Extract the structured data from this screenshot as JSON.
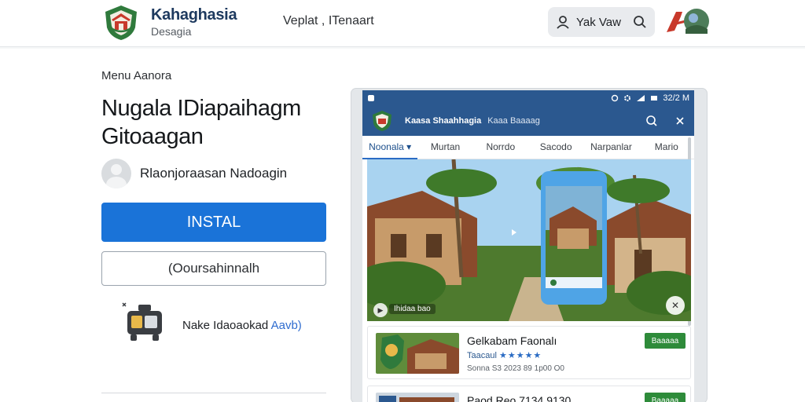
{
  "header": {
    "brand_title": "Kahaghasia",
    "brand_subtitle": "Desagia",
    "nav_text": "Veplat , ITenaart",
    "search_label": "Yak Vaw"
  },
  "main": {
    "breadcrumb": "Menu Aanora",
    "app_title": "Nugala IDiapaihagm Gitoaagan",
    "developer": "Rlaonjoraasan Nadoagin",
    "install_label": "INSTAL",
    "secondary_label": "(Ooursahinnalh",
    "feature_text": "Nake Idaoaokad",
    "feature_accent": "Aavb)"
  },
  "screenshot": {
    "statusbar_time": "32/2 M",
    "appbar_title": "Kaasa Shaahhagia",
    "appbar_subtitle": "Kaaa Baaaag",
    "tabs": [
      "Noonala",
      "Murtan",
      "Norrdo",
      "Sacodo",
      "Narpanlar",
      "Mario"
    ],
    "hero_tag": "Ihidaa bao",
    "items": [
      {
        "title": "Gelkabam Faonalı",
        "subtitle": "Taacaul",
        "stars": "★★★★★",
        "meta": "Sonna S3 2023 89 1p00 O0",
        "button": "Baaaaa"
      },
      {
        "title": "Paod Reo 7134 9130",
        "subtitle": "",
        "stars": "",
        "meta": "",
        "button": "Baaaaa"
      }
    ]
  },
  "colors": {
    "primary": "#1a73d8",
    "appbar": "#2b588f",
    "success": "#2e8b3a",
    "brand_green": "#2f7a3c",
    "brand_red": "#c8392b"
  },
  "icons": {
    "search": "search-icon",
    "user": "user-icon",
    "install": "install-icon",
    "close": "close-icon"
  }
}
